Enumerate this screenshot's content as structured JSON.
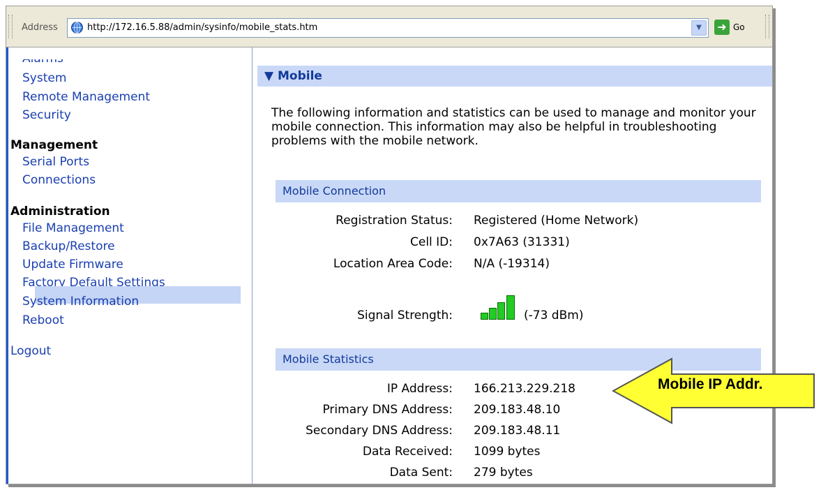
{
  "addressbar": {
    "label": "Address",
    "url": "http://172.16.5.88/admin/sysinfo/mobile_stats.htm",
    "go_label": "Go"
  },
  "sidebar": {
    "cut_item": "Alarms",
    "top_items": [
      "System",
      "Remote Management",
      "Security"
    ],
    "management_heading": "Management",
    "management_items": [
      "Serial Ports",
      "Connections"
    ],
    "administration_heading": "Administration",
    "administration_items": [
      "File Management",
      "Backup/Restore",
      "Update Firmware",
      "Factory Default Settings",
      "System Information",
      "Reboot"
    ],
    "selected": "System Information",
    "logout": "Logout"
  },
  "main": {
    "section_title": "Mobile",
    "intro_text": "The following information and statistics can be used to manage and monitor your mobile connection. This information may also be helpful in troubleshooting problems with the mobile network.",
    "connection": {
      "heading": "Mobile Connection",
      "registration_label": "Registration Status:",
      "registration_value": "Registered (Home Network)",
      "cell_id_label": "Cell ID:",
      "cell_id_value": "0x7A63  (31331)",
      "lac_label": "Location Area Code:",
      "lac_value": "N/A  (-19314)",
      "signal_label": "Signal Strength:",
      "signal_value": "(-73 dBm)",
      "signal_bars_filled": 4,
      "signal_bars_total": 4
    },
    "statistics": {
      "heading": "Mobile Statistics",
      "ip_label": "IP Address:",
      "ip_value": "166.213.229.218",
      "dns1_label": "Primary DNS Address:",
      "dns1_value": "209.183.48.10",
      "dns2_label": "Secondary DNS Address:",
      "dns2_value": "209.183.48.11",
      "rx_label": "Data Received:",
      "rx_value": "1099 bytes",
      "tx_label": "Data Sent:",
      "tx_value": "279 bytes"
    }
  },
  "callout": {
    "text": "Mobile IP Addr.",
    "fill_color": "#ffff33"
  },
  "colors": {
    "link": "#1a3fb0",
    "section_bar": "#c9d8f7",
    "signal_green": "#22cc22"
  }
}
